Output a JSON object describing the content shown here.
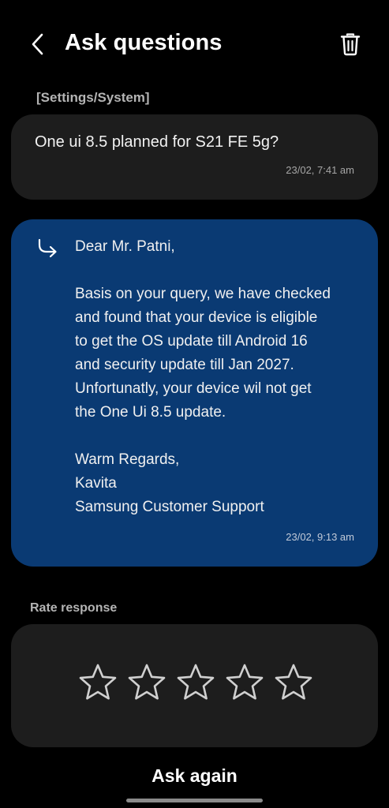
{
  "header": {
    "title": "Ask questions",
    "back_icon": "chevron-left-icon",
    "delete_icon": "trash-icon"
  },
  "category": "[Settings/System]",
  "question": {
    "text": "One ui 8.5 planned for S21 FE 5g?",
    "time": "23/02, 7:41 am"
  },
  "answer": {
    "icon": "reply-arrow-icon",
    "greeting": "Dear Mr. Patni,",
    "body_lines": [
      "Basis on your query, we have checked",
      "and found that your device is eligible",
      "to get the OS update till Android 16",
      "and security update till Jan 2027.",
      "Unfortunatly, your device wil not get",
      "the One Ui 8.5 update."
    ],
    "closing": "Warm Regards,",
    "agent_name": "Kavita",
    "signature": "Samsung Customer Support",
    "time": "23/02, 9:13 am"
  },
  "rating": {
    "label": "Rate response",
    "max_stars": 5,
    "selected": 0
  },
  "ask_again_label": "Ask again",
  "colors": {
    "background": "#000000",
    "card": "#1d1d1d",
    "answer_card": "#0a3a73",
    "secondary_text": "#b4b4b4"
  }
}
